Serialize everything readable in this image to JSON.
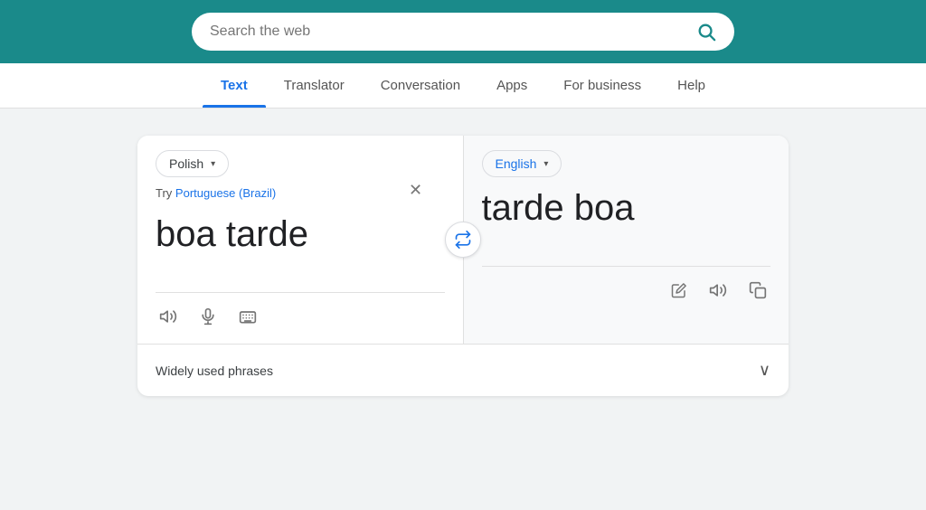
{
  "header": {
    "search_placeholder": "Search the web",
    "bg_color": "#1a8a8a"
  },
  "nav": {
    "items": [
      {
        "label": "Text",
        "active": true
      },
      {
        "label": "Translator",
        "active": false
      },
      {
        "label": "Conversation",
        "active": false
      },
      {
        "label": "Apps",
        "active": false
      },
      {
        "label": "For business",
        "active": false
      },
      {
        "label": "Help",
        "active": false
      }
    ]
  },
  "translator": {
    "source_lang": "Polish",
    "target_lang": "English",
    "try_label": "Try",
    "try_link": "Portuguese (Brazil)",
    "source_text": "boa tarde",
    "result_text": "tarde boa",
    "phrases_label": "Widely used phrases",
    "icons": {
      "search": "🔍",
      "clear": "✕",
      "swap": "⇄",
      "speaker": "🔊",
      "mic": "🎤",
      "keyboard": "⌨",
      "edit": "✏",
      "copy": "📋",
      "chevron_down": "▾",
      "chevron_expand": "∨"
    }
  }
}
